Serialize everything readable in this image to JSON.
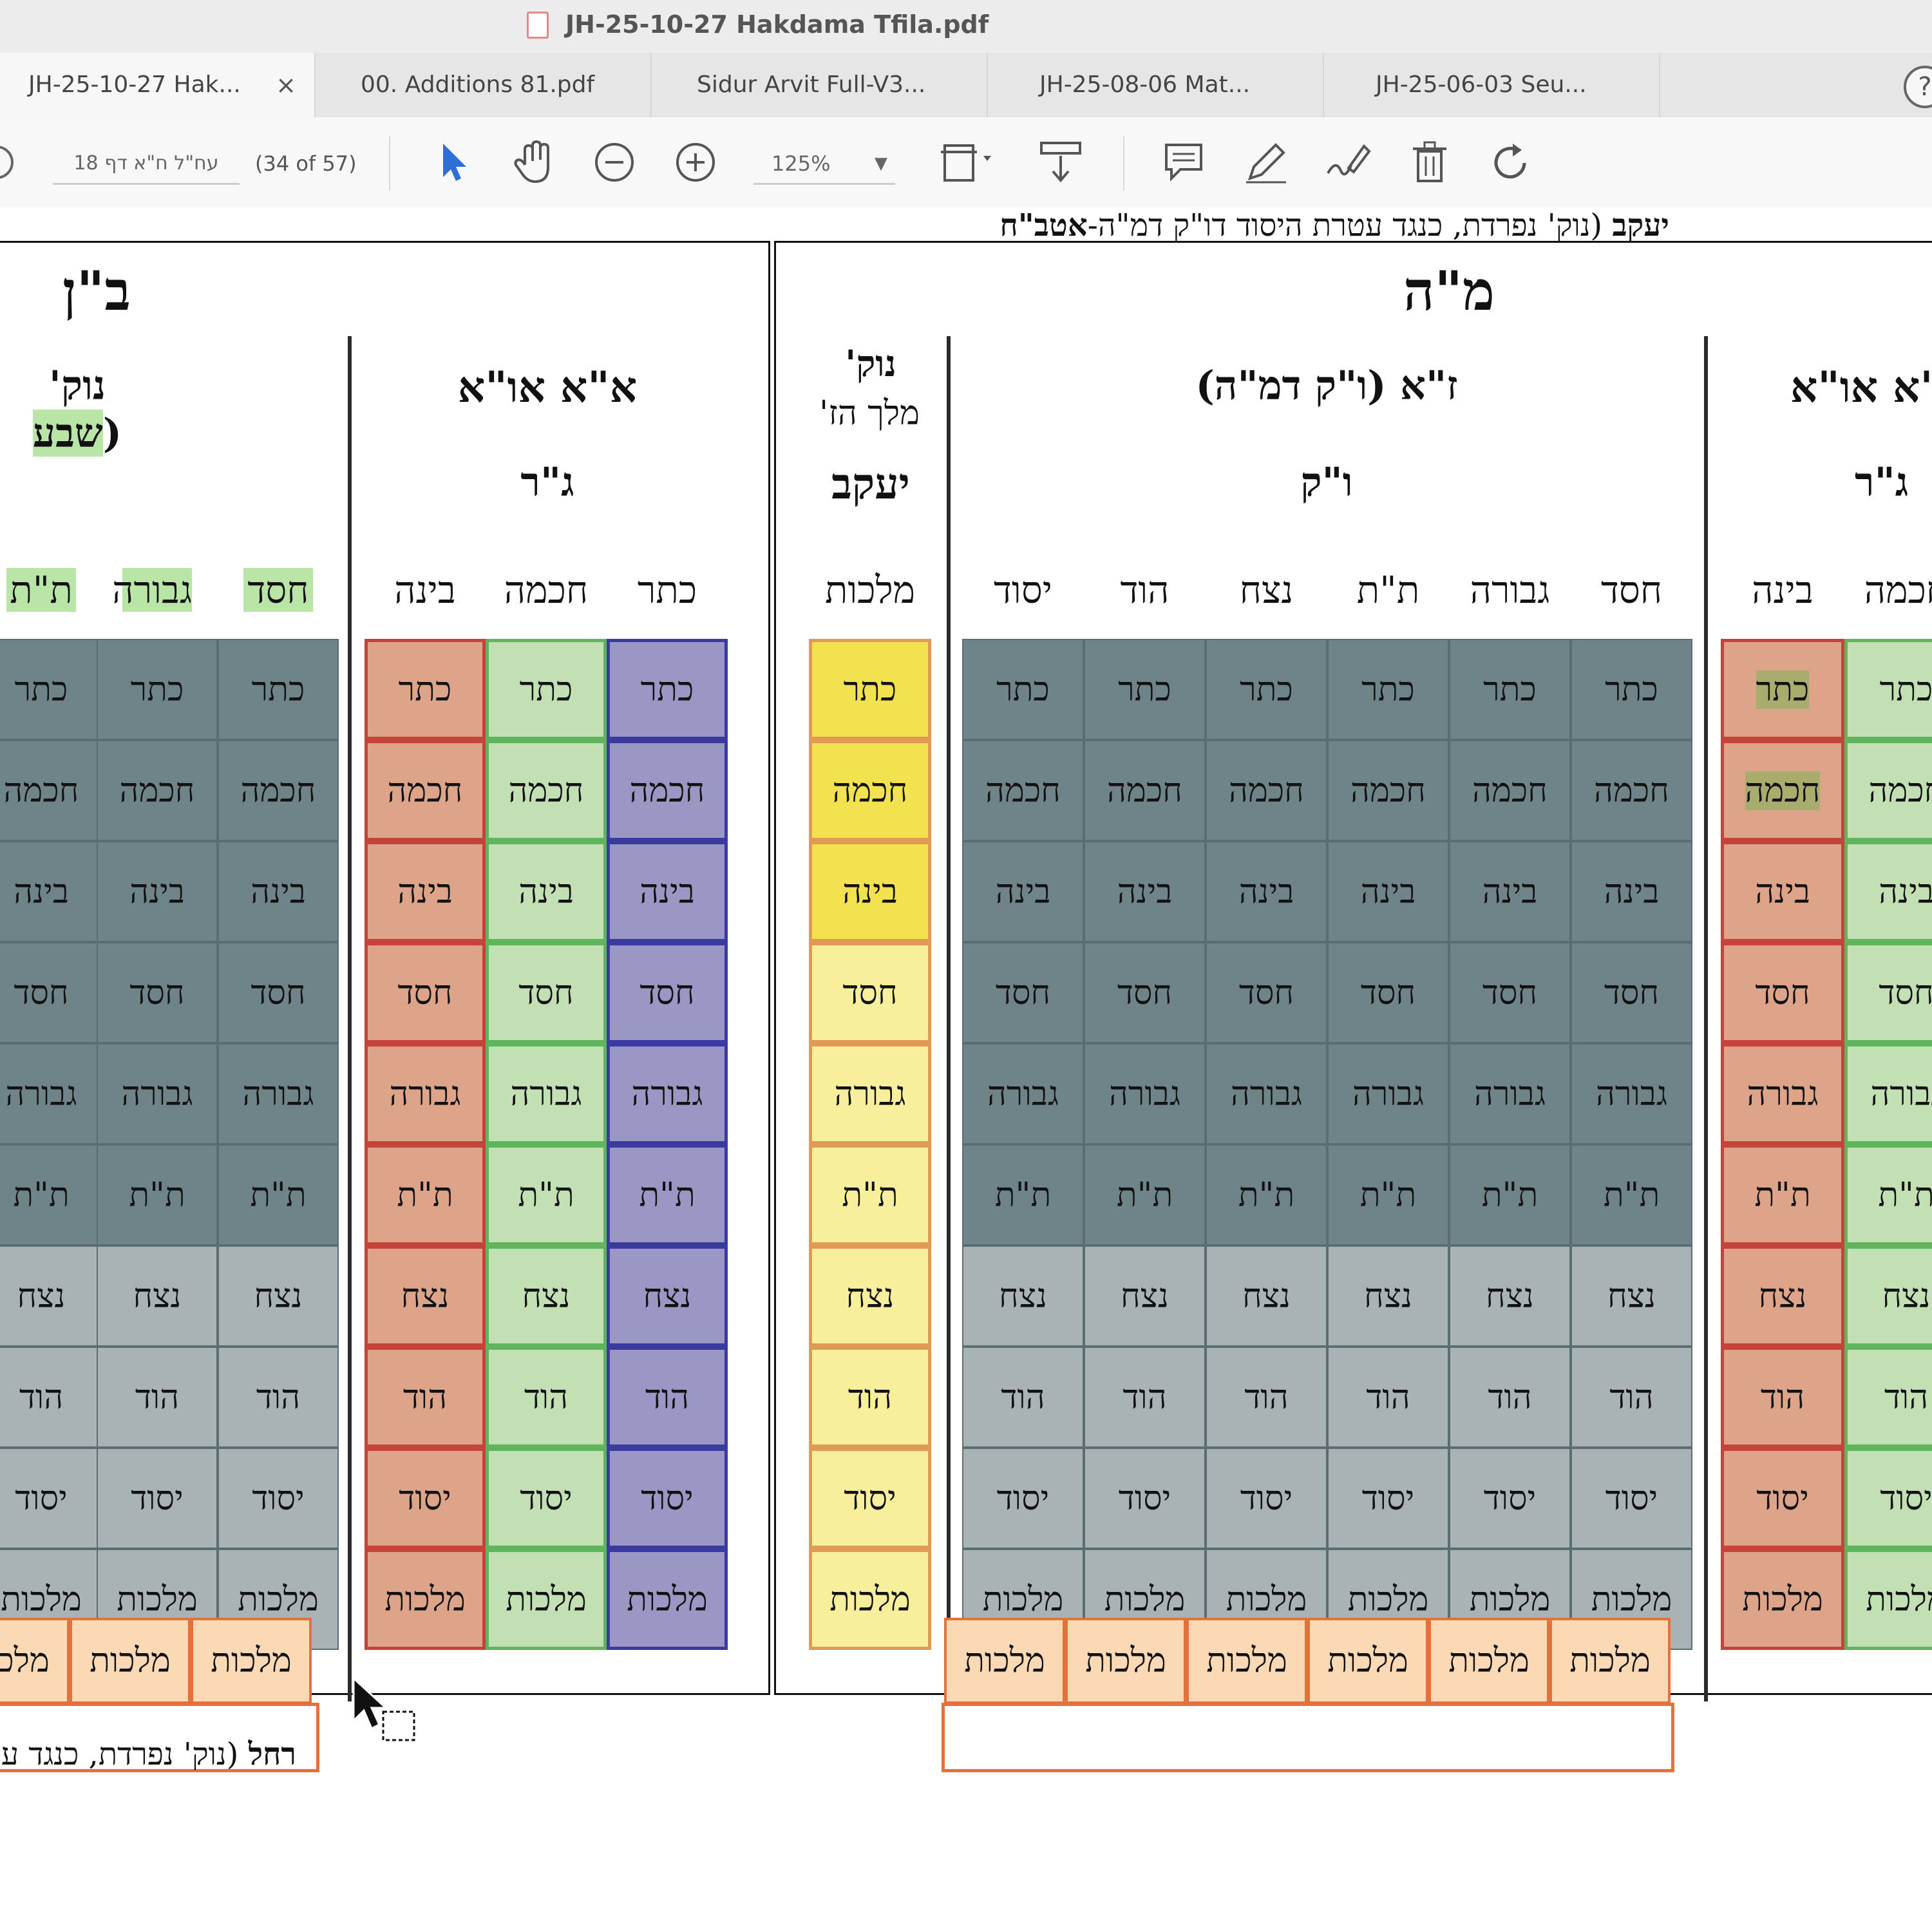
{
  "window": {
    "title": "JH-25-10-27 Hakdama Tfila.pdf"
  },
  "tabs": [
    {
      "label": "JH-25-10-27 Hak...",
      "close": "×"
    },
    {
      "label": "00. Additions 81.pdf"
    },
    {
      "label": "Sidur Arvit Full-V3..."
    },
    {
      "label": "JH-25-08-06 Mat..."
    },
    {
      "label": "JH-25-06-03 Seu..."
    }
  ],
  "toolbar": {
    "page_label": "עח\"ל ח\"א דף 18",
    "page_count": "(34 of 57)",
    "zoom": "125%",
    "help": "?"
  },
  "document": {
    "left_panel_title": "ב\"ן",
    "right_panel_title": "מ\"ה",
    "noq_left": "נוק' (",
    "noq_left_hl": "שבע",
    "aa_left": "א\"א או\"א",
    "gr_left": "ג\"ר",
    "noq_mid_1": "נוק'",
    "noq_mid_2": "מלך הז'",
    "yaakov": "יעקב",
    "za_title": "ז\"א (ו\"ק דמ\"ה)",
    "vk": "ו\"ק",
    "aa_right": "א\"א או\"א",
    "gr_right": "ג\"ר",
    "caption_left_bold": "רחל",
    "caption_left_rest": " (נוק' נפרדת, כנגד ע",
    "caption_right_bold": "יעקב",
    "caption_right_rest": " (נוק' נפרדת, כנגד עטרת היסוד דו\"ק דמ\"ה-",
    "caption_right_bold2": "אטב\"ח",
    "malkhut": "מלכות",
    "headers": {
      "left_noq": [
        "חסד",
        "גבורה",
        "ת\"ת"
      ],
      "left_aa": [
        "כתר",
        "חכמה",
        "בינה"
      ],
      "mid": [
        "מלכות"
      ],
      "za": [
        "חסד",
        "גבורה",
        "ת\"ת",
        "נצח",
        "הוד",
        "יסוד"
      ],
      "right_aa": [
        "חכמה",
        "בינה"
      ]
    },
    "sefirot": [
      "כתר",
      "חכמה",
      "בינה",
      "חסד",
      "גבורה",
      "ת\"ת",
      "נצח",
      "הוד",
      "יסוד",
      "מלכות"
    ]
  },
  "colors": {
    "dark_slate": "#6f8489",
    "light_slate": "#a9b3b6",
    "salmon": "#dda489",
    "salmon_border": "#c5433b",
    "green": "#c3dfb4",
    "green_border": "#5fb55b",
    "purple": "#9a97c4",
    "purple_border": "#3a3aa0",
    "yellow_strong": "#f3e250",
    "yellow_light": "#f7ef9c",
    "yellow_border": "#e19a55",
    "orange_box": "#fbd9b4",
    "orange_border": "#e4703a",
    "highlight_green": "#b9e6a6"
  }
}
